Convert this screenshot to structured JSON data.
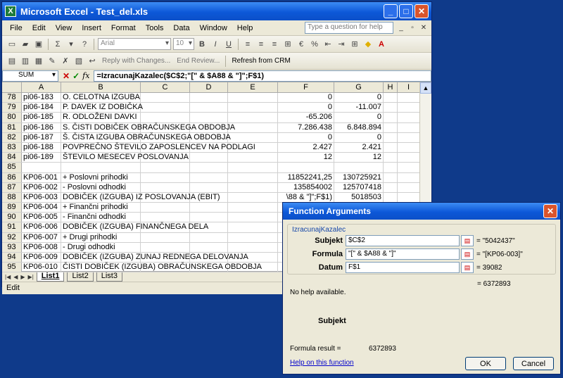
{
  "window": {
    "title": "Microsoft Excel - Test_del.xls",
    "icon_letter": "X"
  },
  "menu": [
    "File",
    "Edit",
    "View",
    "Insert",
    "Format",
    "Tools",
    "Data",
    "Window",
    "Help"
  ],
  "help_placeholder": "Type a question for help",
  "toolbar": {
    "font_name": "Arial",
    "font_size": "10",
    "reply_label": "Reply with Changes...",
    "end_review_label": "End Review...",
    "crm_label": "Refresh from CRM"
  },
  "formula_bar": {
    "name_box": "SUM",
    "formula": "=IzracunajKazalec($C$2;\"[\" & $A88 & \"]\";F$1)"
  },
  "columns": [
    "A",
    "B",
    "C",
    "D",
    "E",
    "F",
    "G",
    "H",
    "I"
  ],
  "rows": [
    {
      "num": "78",
      "a": "pi06-183",
      "b": "O. CELOTNA IZGUBA",
      "f": "0",
      "g": "0"
    },
    {
      "num": "79",
      "a": "pi06-184",
      "b": "P. DAVEK IZ DOBIČKA",
      "f": "0",
      "g": "-11.007"
    },
    {
      "num": "80",
      "a": "pi06-185",
      "b": "R. ODLOŽENI DAVKI",
      "f": "-65.206",
      "g": "0"
    },
    {
      "num": "81",
      "a": "pi06-186",
      "b": "S. ČISTI DOBIČEK OBRAČUNSKEGA OBDOBJA",
      "f": "7.286.438",
      "g": "6.848.894"
    },
    {
      "num": "82",
      "a": "pi06-187",
      "b": "Š. ČISTA  IZGUBA OBRAČUNSKEGA OBDOBJA",
      "f": "0",
      "g": "0"
    },
    {
      "num": "83",
      "a": "pi06-188",
      "b": "   POVPREČNO ŠTEVILO ZAPOSLENCEV NA PODLAGI",
      "f": "2.427",
      "g": "2.421"
    },
    {
      "num": "84",
      "a": "pi06-189",
      "b": "   ŠTEVILO MESECEV POSLOVANJA",
      "f": "12",
      "g": "12"
    },
    {
      "num": "85",
      "a": "",
      "b": "",
      "f": "",
      "g": ""
    },
    {
      "num": "86",
      "a": "KP06-001",
      "b": "+ Poslovni prihodki",
      "f": "11852241,25",
      "g": "130725921"
    },
    {
      "num": "87",
      "a": "KP06-002",
      "b": "- Poslovni odhodki",
      "f": "135854002",
      "g": "125707418"
    },
    {
      "num": "88",
      "a": "KP06-003",
      "b": "DOBIČEK (IZGUBA) IZ POSLOVANJA (EBIT)",
      "f": "\\88 & \"]\";F$1)",
      "g": "5018503"
    },
    {
      "num": "89",
      "a": "KP06-004",
      "b": "+ Finančni prihodki",
      "f": "4449862",
      "g": "6795354"
    },
    {
      "num": "90",
      "a": "KP06-005",
      "b": "- Finančni odhodki",
      "f": "",
      "g": ""
    },
    {
      "num": "91",
      "a": "KP06-006",
      "b": "DOBIČEK (IZGUBA) FINANČNEGA DELA",
      "f": "",
      "g": ""
    },
    {
      "num": "92",
      "a": "KP06-007",
      "b": "+ Drugi prihodki",
      "f": "",
      "g": ""
    },
    {
      "num": "93",
      "a": "KP06-008",
      "b": "- Drugi odhodki",
      "f": "",
      "g": ""
    },
    {
      "num": "94",
      "a": "KP06-009",
      "b": "DOBIČEK (IZGUBA) ZUNAJ REDNEGA DELOVANJA",
      "f": "",
      "g": ""
    },
    {
      "num": "95",
      "a": "KP06-010",
      "b": "ČISTI DOBIČEK (IZGUBA) OBRAČUNSKEGA OBDOBJA",
      "f": "",
      "g": ""
    }
  ],
  "sheets": [
    "List1",
    "List2",
    "List3"
  ],
  "status": "Edit",
  "dialog": {
    "title": "Function Arguments",
    "function_name": "IzracunajKazalec",
    "args": [
      {
        "label": "Subjekt",
        "input": "$C$2",
        "value": "= \"5042437\""
      },
      {
        "label": "Formula",
        "input": "\"[\" & $A88 & \"]\"",
        "value": "= \"[KP06-003]\""
      },
      {
        "label": "Datum",
        "input": "F$1",
        "value": "= 39082"
      }
    ],
    "result_top": "= 6372893",
    "no_help": "No help available.",
    "arg_heading": "Subjekt",
    "formula_result_label": "Formula result =",
    "formula_result_value": "6372893",
    "help_link": "Help on this function",
    "ok": "OK",
    "cancel": "Cancel"
  }
}
